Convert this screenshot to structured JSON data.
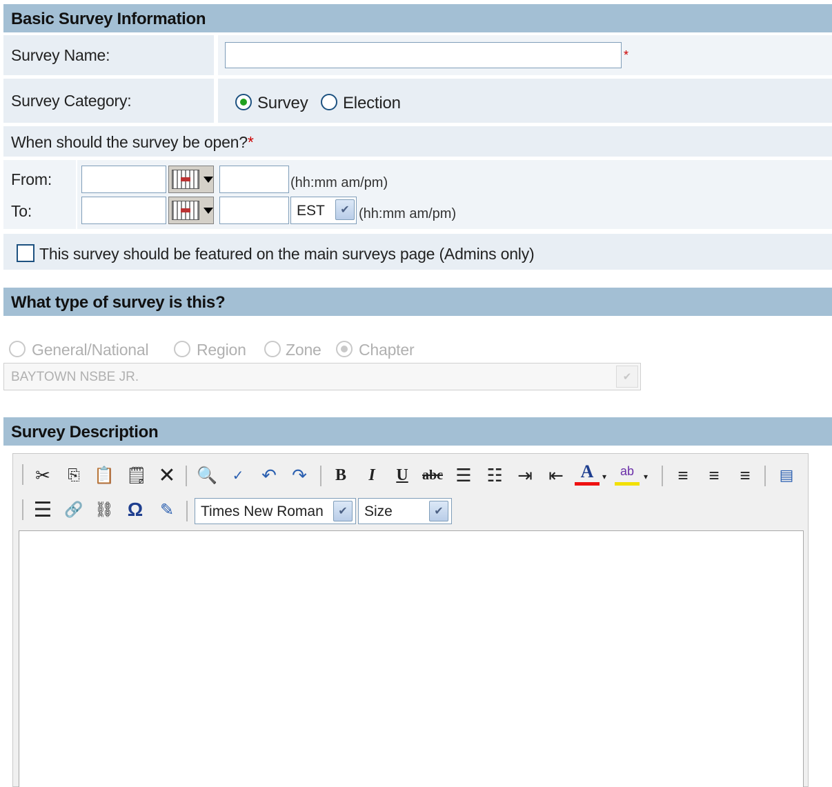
{
  "basic": {
    "header": "Basic Survey Information",
    "survey_name_label": "Survey Name:",
    "survey_name_value": "",
    "required_mark": "*",
    "category_label": "Survey Category:",
    "category_options": [
      "Survey",
      "Election"
    ],
    "category_selected": "Survey",
    "open_question": "When should the survey be open?",
    "from_label": "From:",
    "to_label": "To:",
    "time_hint": "(hh:mm am/pm)",
    "timezone_value": "EST",
    "featured_label": "This survey should be featured on the main surveys page (Admins only)",
    "featured_checked": false
  },
  "type": {
    "header": "What type of survey is this?",
    "options": [
      "General/National",
      "Region",
      "Zone",
      "Chapter"
    ],
    "selected": "Chapter",
    "chapter_value": "BAYTOWN NSBE JR."
  },
  "description": {
    "header": "Survey Description",
    "font_value": "Times New Roman",
    "size_value": "Size",
    "icons_row1": [
      "cut-icon",
      "copy-icon",
      "paste-icon",
      "paste-word-icon",
      "clear-format-icon",
      "find-icon",
      "spellcheck-icon",
      "undo-icon",
      "redo-icon",
      "bold-icon",
      "italic-icon",
      "underline-icon",
      "strikethrough-icon",
      "ordered-list-icon",
      "unordered-list-icon",
      "indent-icon",
      "outdent-icon",
      "font-color-icon",
      "highlight-icon",
      "align-left-icon",
      "align-center-icon",
      "align-right-icon",
      "source-icon"
    ],
    "icons_row2": [
      "horizontal-rule-icon",
      "link-icon",
      "unlink-icon",
      "special-char-icon",
      "edit-image-icon"
    ]
  }
}
